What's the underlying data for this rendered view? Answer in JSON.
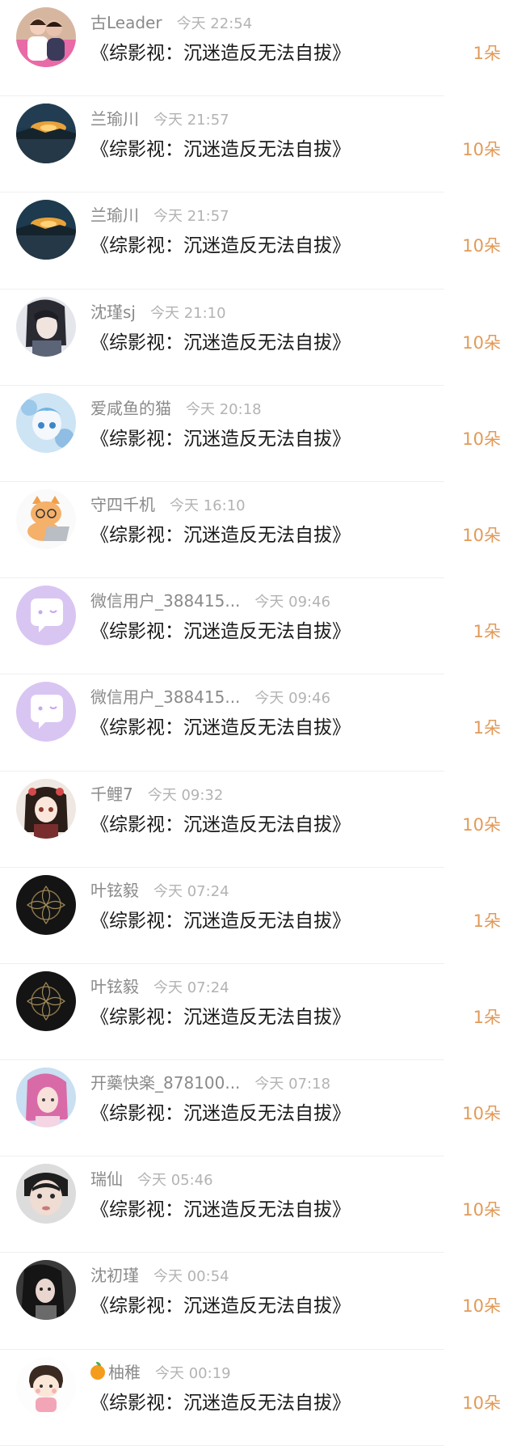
{
  "items": [
    {
      "name": "古Leader",
      "time": "今天 22:54",
      "title": "《综影视：沉迷造反无法自拔》",
      "gift": "1朵",
      "avatar": "avatar-couple"
    },
    {
      "name": "兰瑜川",
      "time": "今天 21:57",
      "title": "《综影视：沉迷造反无法自拔》",
      "gift": "10朵",
      "avatar": "avatar-sunset"
    },
    {
      "name": "兰瑜川",
      "time": "今天 21:57",
      "title": "《综影视：沉迷造反无法自拔》",
      "gift": "10朵",
      "avatar": "avatar-sunset"
    },
    {
      "name": "沈瑾sj",
      "time": "今天 21:10",
      "title": "《综影视：沉迷造反无法自拔》",
      "gift": "10朵",
      "avatar": "avatar-anime-dark"
    },
    {
      "name": "爱咸鱼的猫",
      "time": "今天 20:18",
      "title": "《综影视：沉迷造反无法自拔》",
      "gift": "10朵",
      "avatar": "avatar-anime-blue"
    },
    {
      "name": "守四千机",
      "time": "今天 16:10",
      "title": "《综影视：沉迷造反无法自拔》",
      "gift": "10朵",
      "avatar": "avatar-cat-laptop"
    },
    {
      "name": "微信用户_388415...",
      "time": "今天 09:46",
      "title": "《综影视：沉迷造反无法自拔》",
      "gift": "1朵",
      "avatar": "avatar-wechat-default"
    },
    {
      "name": "微信用户_388415...",
      "time": "今天 09:46",
      "title": "《综影视：沉迷造反无法自拔》",
      "gift": "1朵",
      "avatar": "avatar-wechat-default"
    },
    {
      "name": "千鲤7",
      "time": "今天 09:32",
      "title": "《综影视：沉迷造反无法自拔》",
      "gift": "10朵",
      "avatar": "avatar-anime-girl"
    },
    {
      "name": "叶铉毅",
      "time": "今天 07:24",
      "title": "《综影视：沉迷造反无法自拔》",
      "gift": "1朵",
      "avatar": "avatar-dark-floral"
    },
    {
      "name": "叶铉毅",
      "time": "今天 07:24",
      "title": "《综影视：沉迷造反无法自拔》",
      "gift": "1朵",
      "avatar": "avatar-dark-floral"
    },
    {
      "name": "开藥快楽_878100...",
      "time": "今天 07:18",
      "title": "《综影视：沉迷造反无法自拔》",
      "gift": "10朵",
      "avatar": "avatar-pink-hair"
    },
    {
      "name": "瑞仙",
      "time": "今天 05:46",
      "title": "《综影视：沉迷造反无法自拔》",
      "gift": "10朵",
      "avatar": "avatar-photo-face"
    },
    {
      "name": "沈初瑾",
      "time": "今天 00:54",
      "title": "《综影视：沉迷造反无法自拔》",
      "gift": "10朵",
      "avatar": "avatar-photo-dark"
    },
    {
      "name": "柚稚",
      "time": "今天 00:19",
      "title": "《综影视：沉迷造反无法自拔》",
      "gift": "10朵",
      "avatar": "avatar-cartoon-girl",
      "emoji": "orange-emoji-icon"
    }
  ],
  "colors": {
    "name": "#8a8a8a",
    "time": "#b3b3b3",
    "title": "#1a1a1a",
    "gift": "#e29a58"
  }
}
